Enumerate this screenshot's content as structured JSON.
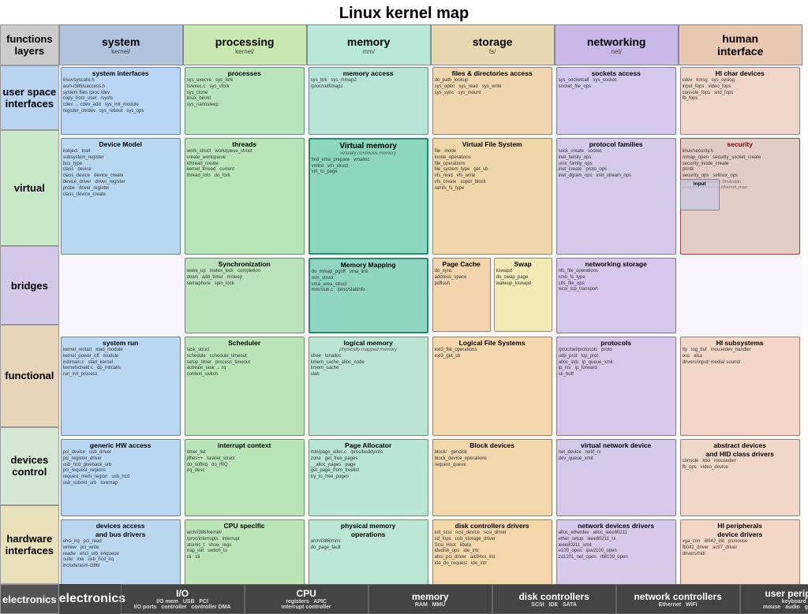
{
  "title": "Linux kernel map",
  "layers": {
    "header": {
      "line1": "functions",
      "line2": "layers"
    },
    "userspace": "user space\ninterfaces",
    "virtual": "virtual",
    "bridges": "bridges",
    "functional": "functional",
    "devices_control": "devices\ncontrol",
    "hardware": "hardware\ninterfaces",
    "electronics": "electronics"
  },
  "columns": [
    {
      "name": "system",
      "path": "kernel/",
      "color": "#b0c4de"
    },
    {
      "name": "processing",
      "path": "kernel/",
      "color": "#c8e8b0"
    },
    {
      "name": "memory",
      "path": "mm/",
      "color": "#b8e8d8"
    },
    {
      "name": "storage",
      "path": "fs/",
      "color": "#e8d8b0"
    },
    {
      "name": "networking",
      "path": "net/",
      "color": "#c8b8e8"
    },
    {
      "name": "human interface",
      "path": "",
      "color": "#e8c8b0"
    }
  ],
  "sections": {
    "system_interfaces": {
      "title": "system interfaces",
      "items": [
        "linux/syscalls.h",
        "asm-i386/uaccess.h",
        "system files",
        "/proc /dev",
        "copy_from_user",
        "/sysfs"
      ]
    },
    "memory_access": {
      "title": "memory access",
      "items": [
        "sys_brk",
        "sys_mmap2"
      ]
    },
    "sockets_access": {
      "title": "sockets access",
      "items": [
        "sys_socketcall",
        "sys_socket"
      ]
    },
    "hi_char_devices": {
      "title": "HI char devices",
      "items": [
        "cdev",
        "input_fops",
        "console_fops",
        "fb_fops"
      ]
    },
    "files_directories": {
      "title": "files & directories access",
      "items": [
        "sys_open",
        "sys_read",
        "sys_write"
      ]
    },
    "device_model": {
      "title": "Device Model",
      "items": [
        "kobject",
        "kset",
        "subsystem_register",
        "bus_type",
        "class",
        "device"
      ]
    },
    "virtual_memory": {
      "title": "Virtual memory",
      "subtitle": "virtually continues memory",
      "items": [
        "find_vma_prepare",
        "vmalloc",
        "vmlist",
        "vm_struct",
        "virt_to_page"
      ]
    },
    "virtual_file_system": {
      "title": "Virtual File System",
      "items": [
        "file",
        "inode",
        "file_operations",
        "file_system_type",
        "get_sb"
      ]
    },
    "protocol_families": {
      "title": "protocol families",
      "items": [
        "sock_create",
        "socket",
        "inet_family_ops",
        "unix_family_ops",
        "inet_create",
        "proto_ops"
      ]
    },
    "security": {
      "title": "security",
      "items": [
        "mmap_open",
        "security_socket_create",
        "security_inode_create",
        "printk",
        "security_ops",
        "selinux_ops"
      ]
    },
    "synchronization": {
      "title": "Synchronization",
      "items": [
        "wake_up",
        "mutex_lock",
        "completion",
        "down",
        "add_timer",
        "msleep",
        "semaphore",
        "spin_lock"
      ]
    },
    "memory_mapping": {
      "title": "Memory Mapping",
      "items": [
        "do_mmap_pgoff",
        "vma_link",
        "mm_struct",
        "vma_area_struct"
      ]
    },
    "page_cache": {
      "title": "Page Cache",
      "items": [
        "do_sync",
        "address_space",
        "pdflush"
      ]
    },
    "networking_storage": {
      "title": "networking storage",
      "items": [
        "nfs_file_operations",
        "smb_fs_type",
        "cifs_file_ops",
        "iscsi_tcp_transport"
      ]
    },
    "threads": {
      "title": "threads",
      "items": [
        "work_struct",
        "workqueue_struct",
        "create_workqueue",
        "kthread_create",
        "kernel_thread",
        "current",
        "thread_info",
        "do_fork"
      ]
    },
    "swap": {
      "title": "Swap",
      "items": [
        "kswapd",
        "do_swap_page",
        "wakeup_kswapd"
      ]
    },
    "protocols": {
      "title": "protocols",
      "items": [
        "/proc/net/protocols",
        "proto",
        "udp_prot",
        "tcp_prot"
      ]
    },
    "hi_subsystems": {
      "title": "HI subsystems",
      "items": [
        "tty",
        "log_buf",
        "oss",
        "alsa"
      ]
    },
    "scheduler": {
      "title": "Scheduler",
      "items": [
        "task_struct",
        "schedule",
        "schedule_timeout",
        "setup_timer",
        "process_timeout",
        "activate_task",
        "rq",
        "context_switch"
      ]
    },
    "logical_memory": {
      "title": "logical memory",
      "subtitle": "physically mapped memory",
      "items": [
        "sfree",
        "kmalloc",
        "kmem_cache_alloc_node",
        "kmem_cache"
      ]
    },
    "logical_file_systems": {
      "title": "Logical File Systems",
      "items": [
        "ext3_file_operations",
        "ext3_get_sb"
      ]
    },
    "system_run": {
      "title": "system run",
      "items": [
        "kernel_restart",
        "load_module",
        "kernel_power_off",
        "module",
        "init/main.c",
        "start_kernel"
      ]
    },
    "generic_hw_access": {
      "title": "generic HW access",
      "items": [
        "pci_device",
        "usb_driver",
        "pci_register_driver",
        "usb_hcd_giveback_urb",
        "pci_request_regions",
        "request_mem_region",
        "usb_hcd",
        "usb_submit_urb"
      ]
    },
    "interrupt_context": {
      "title": "interrupt context",
      "items": [
        "timer_list",
        "jiffies++",
        "tasklet_struct",
        "do_softirq",
        "do_IRQ",
        "irq_desc"
      ]
    },
    "page_allocator": {
      "title": "Page Allocator",
      "items": [
        "zone",
        "get_free_pages",
        "__alloc_pages",
        "page",
        "get_page_from_freelist",
        "try_to_free_pages"
      ]
    },
    "block_devices": {
      "title": "Block devices",
      "items": [
        "block/",
        "gendisk",
        "block_device_operations",
        "request_queue"
      ]
    },
    "virtual_network_device": {
      "title": "virtual network device",
      "items": [
        "net_device",
        "netif_rx",
        "dev_queue_xmit"
      ]
    },
    "abstract_hid_drivers": {
      "title": "abstract devices and HID class drivers",
      "items": [
        "console",
        "kbd",
        "mousedev",
        "fb_ops",
        "video_device"
      ]
    },
    "cpu_specific": {
      "title": "CPU specific",
      "items": [
        "arch/i386/kernel/",
        "/proc/interrupts",
        "interrupt",
        "atomic_t",
        "show_regs",
        "trap_init",
        "switch_to",
        "cli",
        "sti"
      ]
    },
    "physical_memory": {
      "title": "physical memory operations",
      "items": [
        "arch/i386/mm/",
        "do_page_fault"
      ]
    },
    "disk_controllers_drivers": {
      "title": "disk controllers drivers",
      "items": [
        "init_scsi",
        "scsi_device",
        "scsi_driver",
        "sd_fops",
        "usb_storage_driver",
        "Scsi_Host",
        "libata",
        "idedisk_ops",
        "ide_intr",
        "ahci_pci_driver",
        "aic94xx_init",
        "ide_do_request"
      ]
    },
    "network_devices_drivers": {
      "title": "network devices drivers",
      "items": [
        "alloc_etherdev",
        "alloc_ieee80211",
        "ether_setup",
        "ieee80211_rx",
        "ieee80211_xmit",
        "e100_open",
        "ipw2100_open",
        "zd1201_net_open",
        "rtl8139_open"
      ]
    },
    "hi_peripherals_drivers": {
      "title": "HI peripherals device drivers",
      "items": [
        "vga_con",
        "i8042_init",
        "psmouse",
        "fb042_driver",
        "ac97_driver"
      ]
    },
    "devices_bus_drivers": {
      "title": "devices access and bus drivers",
      "items": [
        "ehci_irq",
        "writew",
        "readw",
        "pci_read",
        "pci_write",
        "ehci_urb_enqueue",
        "outw",
        "inw",
        "usb_hcd_irq"
      ]
    }
  },
  "electronics": {
    "label": "electronics",
    "cells": [
      {
        "big": "I/O",
        "label": "I/O mem",
        "sub": "I/O ports",
        "extra": "USB\ncontroller",
        "extra2": "PCI\ncontroller DMA"
      },
      {
        "big": "CPU",
        "label": "registers",
        "sub": "APIC",
        "extra": "interrupt\ncontroller"
      },
      {
        "big": "memory",
        "label": "RAM",
        "sub": "MMU"
      },
      {
        "big": "disk controllers",
        "label": "SCSI",
        "sub": "IDE SATA"
      },
      {
        "big": "network controllers",
        "label": "Ethernet",
        "sub": "WiFi"
      },
      {
        "big": "user peripherals",
        "label": "keyboard",
        "sub": "cam\nmouse audio\ngraphics card"
      }
    ]
  }
}
